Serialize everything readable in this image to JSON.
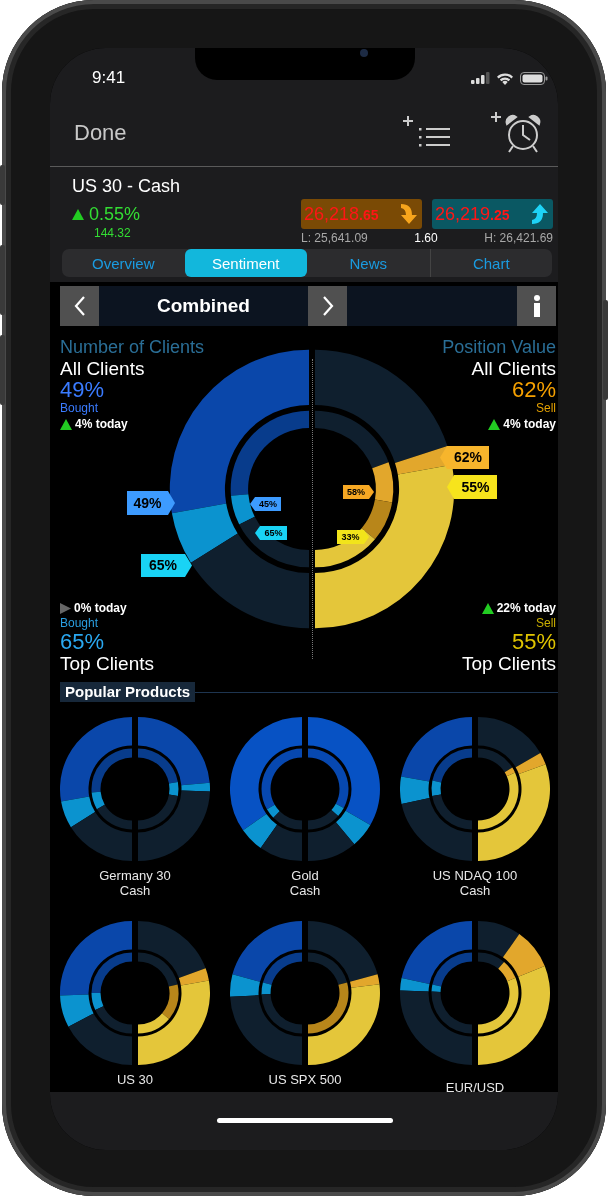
{
  "status_bar": {
    "time": "9:41"
  },
  "nav": {
    "done": "Done"
  },
  "instrument": {
    "name": "US 30 - Cash",
    "change": "0.55%",
    "rising": true,
    "change_points": "144.32",
    "sell": "26,218**.65**",
    "sell_rising": false,
    "buy": "26,219**.25**",
    "buy_rising": true,
    "low": "L: 25,641.09",
    "spread": "1.60",
    "high": "H: 26,421.69"
  },
  "tabs": [
    {
      "label": "Overview",
      "selected": false
    },
    {
      "label": "Sentiment",
      "selected": true
    },
    {
      "label": "News",
      "selected": false
    },
    {
      "label": "Chart",
      "selected": false
    }
  ],
  "view_selector": {
    "label": "Combined"
  },
  "sentiment": {
    "panels": [
      {
        "title": "Number of Clients",
        "all_clients": {
          "label": "All Clients",
          "value": "49%",
          "side": "Bought",
          "today": "4% today",
          "rising": true
        },
        "top_clients": {
          "today": "0% today",
          "rising": false,
          "side": "Bought",
          "value": "65%",
          "label": "Top Clients"
        }
      },
      {
        "title": "Position Value",
        "all_clients": {
          "label": "All Clients",
          "value": "62%",
          "side": "Sell",
          "today": "4% today",
          "rising": true
        },
        "top_clients": {
          "today": "22% today",
          "rising": true,
          "side": "Sell",
          "value": "55%",
          "label": "Top Clients"
        }
      }
    ],
    "callouts": [
      {
        "text": "49%",
        "color": "#3d9bff"
      },
      {
        "text": "65%",
        "color": "#19d3f5"
      },
      {
        "text": "45%",
        "color": "#3d9bff"
      },
      {
        "text": "65%",
        "color": "#19d3f5"
      },
      {
        "text": "62%",
        "color": "#f7b52c"
      },
      {
        "text": "55%",
        "color": "#f7e41c"
      },
      {
        "text": "58%",
        "color": "#f7a823"
      },
      {
        "text": "33%",
        "color": "#f2e41a"
      }
    ]
  },
  "popular_products": {
    "title": "Popular Products",
    "items": [
      {
        "name": "Germany 30",
        "sub": "Cash"
      },
      {
        "name": "Gold",
        "sub": "Cash"
      },
      {
        "name": "US NDAQ 100",
        "sub": "Cash"
      },
      {
        "name": "US 30"
      },
      {
        "name": "US SPX 500"
      },
      {
        "name": "EUR/USD"
      }
    ]
  }
}
